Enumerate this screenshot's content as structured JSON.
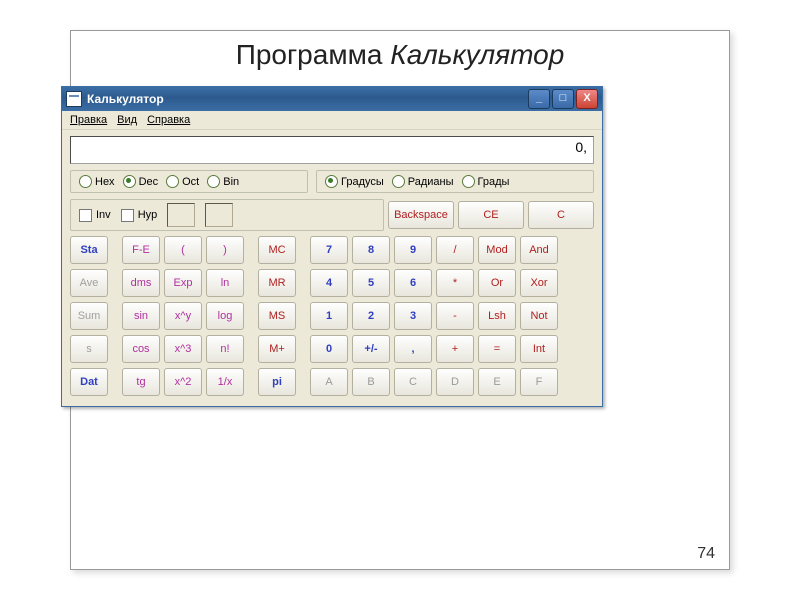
{
  "slide": {
    "title_plain": "Программа ",
    "title_em": "Калькулятор",
    "page_number": "74"
  },
  "window": {
    "title": "Калькулятор",
    "buttons": {
      "min": "_",
      "max": "□",
      "close": "X"
    }
  },
  "menu": {
    "edit": "Правка",
    "view": "Вид",
    "help": "Справка"
  },
  "display": {
    "value": "0,"
  },
  "radix": {
    "hex": "Hex",
    "dec": "Dec",
    "oct": "Oct",
    "bin": "Bin",
    "selected": "dec"
  },
  "angle": {
    "deg": "Градусы",
    "rad": "Радианы",
    "grad": "Грады",
    "selected": "deg"
  },
  "flags": {
    "inv": "Inv",
    "hyp": "Hyp"
  },
  "clear": {
    "backspace": "Backspace",
    "ce": "CE",
    "c": "C"
  },
  "rows": [
    {
      "stat": "Sta",
      "f1": "F-E",
      "f2": "(",
      "f3": ")",
      "mem": "MC",
      "d1": "7",
      "d2": "8",
      "d3": "9",
      "op": "/",
      "x1": "Mod",
      "x2": "And"
    },
    {
      "stat": "Ave",
      "f1": "dms",
      "f2": "Exp",
      "f3": "ln",
      "mem": "MR",
      "d1": "4",
      "d2": "5",
      "d3": "6",
      "op": "*",
      "x1": "Or",
      "x2": "Xor"
    },
    {
      "stat": "Sum",
      "f1": "sin",
      "f2": "x^y",
      "f3": "log",
      "mem": "MS",
      "d1": "1",
      "d2": "2",
      "d3": "3",
      "op": "-",
      "x1": "Lsh",
      "x2": "Not"
    },
    {
      "stat": "s",
      "f1": "cos",
      "f2": "x^3",
      "f3": "n!",
      "mem": "M+",
      "d1": "0",
      "d2": "+/-",
      "d3": ",",
      "op": "+",
      "x1": "=",
      "x2": "Int"
    },
    {
      "stat": "Dat",
      "f1": "tg",
      "f2": "x^2",
      "f3": "1/x",
      "mem": "pi",
      "d1": "A",
      "d2": "B",
      "d3": "C",
      "op": "D",
      "x1": "E",
      "x2": "F"
    }
  ]
}
